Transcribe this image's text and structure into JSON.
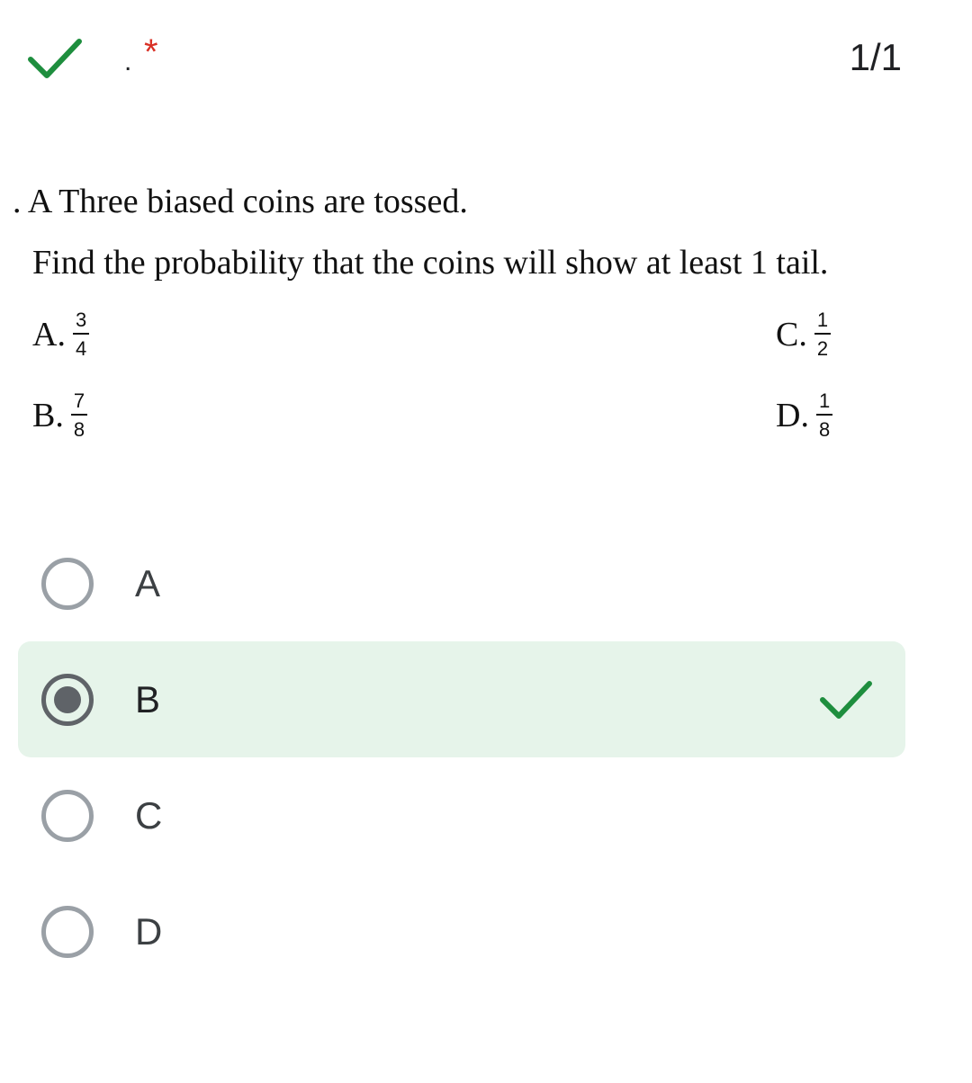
{
  "header": {
    "title": ".",
    "required_marker": "*",
    "score": "1/1",
    "status_icon": "check-icon",
    "accent_color": "#1e8e3e"
  },
  "question": {
    "line1": ". A Three biased coins are tossed.",
    "line2": "Find the probability that the coins will show at least 1 tail.",
    "options": [
      {
        "letter": "A.",
        "numerator": "3",
        "denominator": "4"
      },
      {
        "letter": "B.",
        "numerator": "7",
        "denominator": "8"
      },
      {
        "letter": "C.",
        "numerator": "1",
        "denominator": "2"
      },
      {
        "letter": "D.",
        "numerator": "1",
        "denominator": "8"
      }
    ]
  },
  "choices": [
    {
      "label": "A",
      "selected": false
    },
    {
      "label": "B",
      "selected": true,
      "correct": true
    },
    {
      "label": "C",
      "selected": false
    },
    {
      "label": "D",
      "selected": false
    }
  ],
  "colors": {
    "selected_bg": "#e6f4ea",
    "correct": "#1e8e3e",
    "required": "#d93025"
  }
}
